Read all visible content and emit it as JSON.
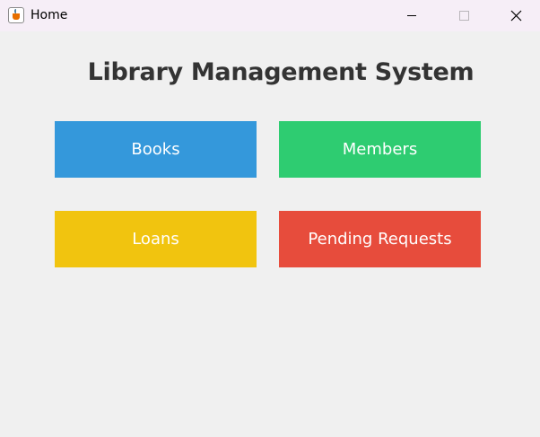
{
  "window": {
    "title": "Home",
    "icon": "java-app-icon",
    "controls": [
      "minimize-icon",
      "maximize-icon",
      "close-icon"
    ]
  },
  "main": {
    "heading": "Library Management System",
    "buttons": [
      {
        "label": "Books",
        "color": "#3498db"
      },
      {
        "label": "Members",
        "color": "#2ecc71"
      },
      {
        "label": "Loans",
        "color": "#f1c40f"
      },
      {
        "label": "Pending Requests",
        "color": "#e74c3c"
      }
    ]
  },
  "colors": {
    "background": "#f0f0f0",
    "titlebar": "#f6eef7",
    "heading_text": "#333333",
    "button_text": "#ffffff"
  }
}
